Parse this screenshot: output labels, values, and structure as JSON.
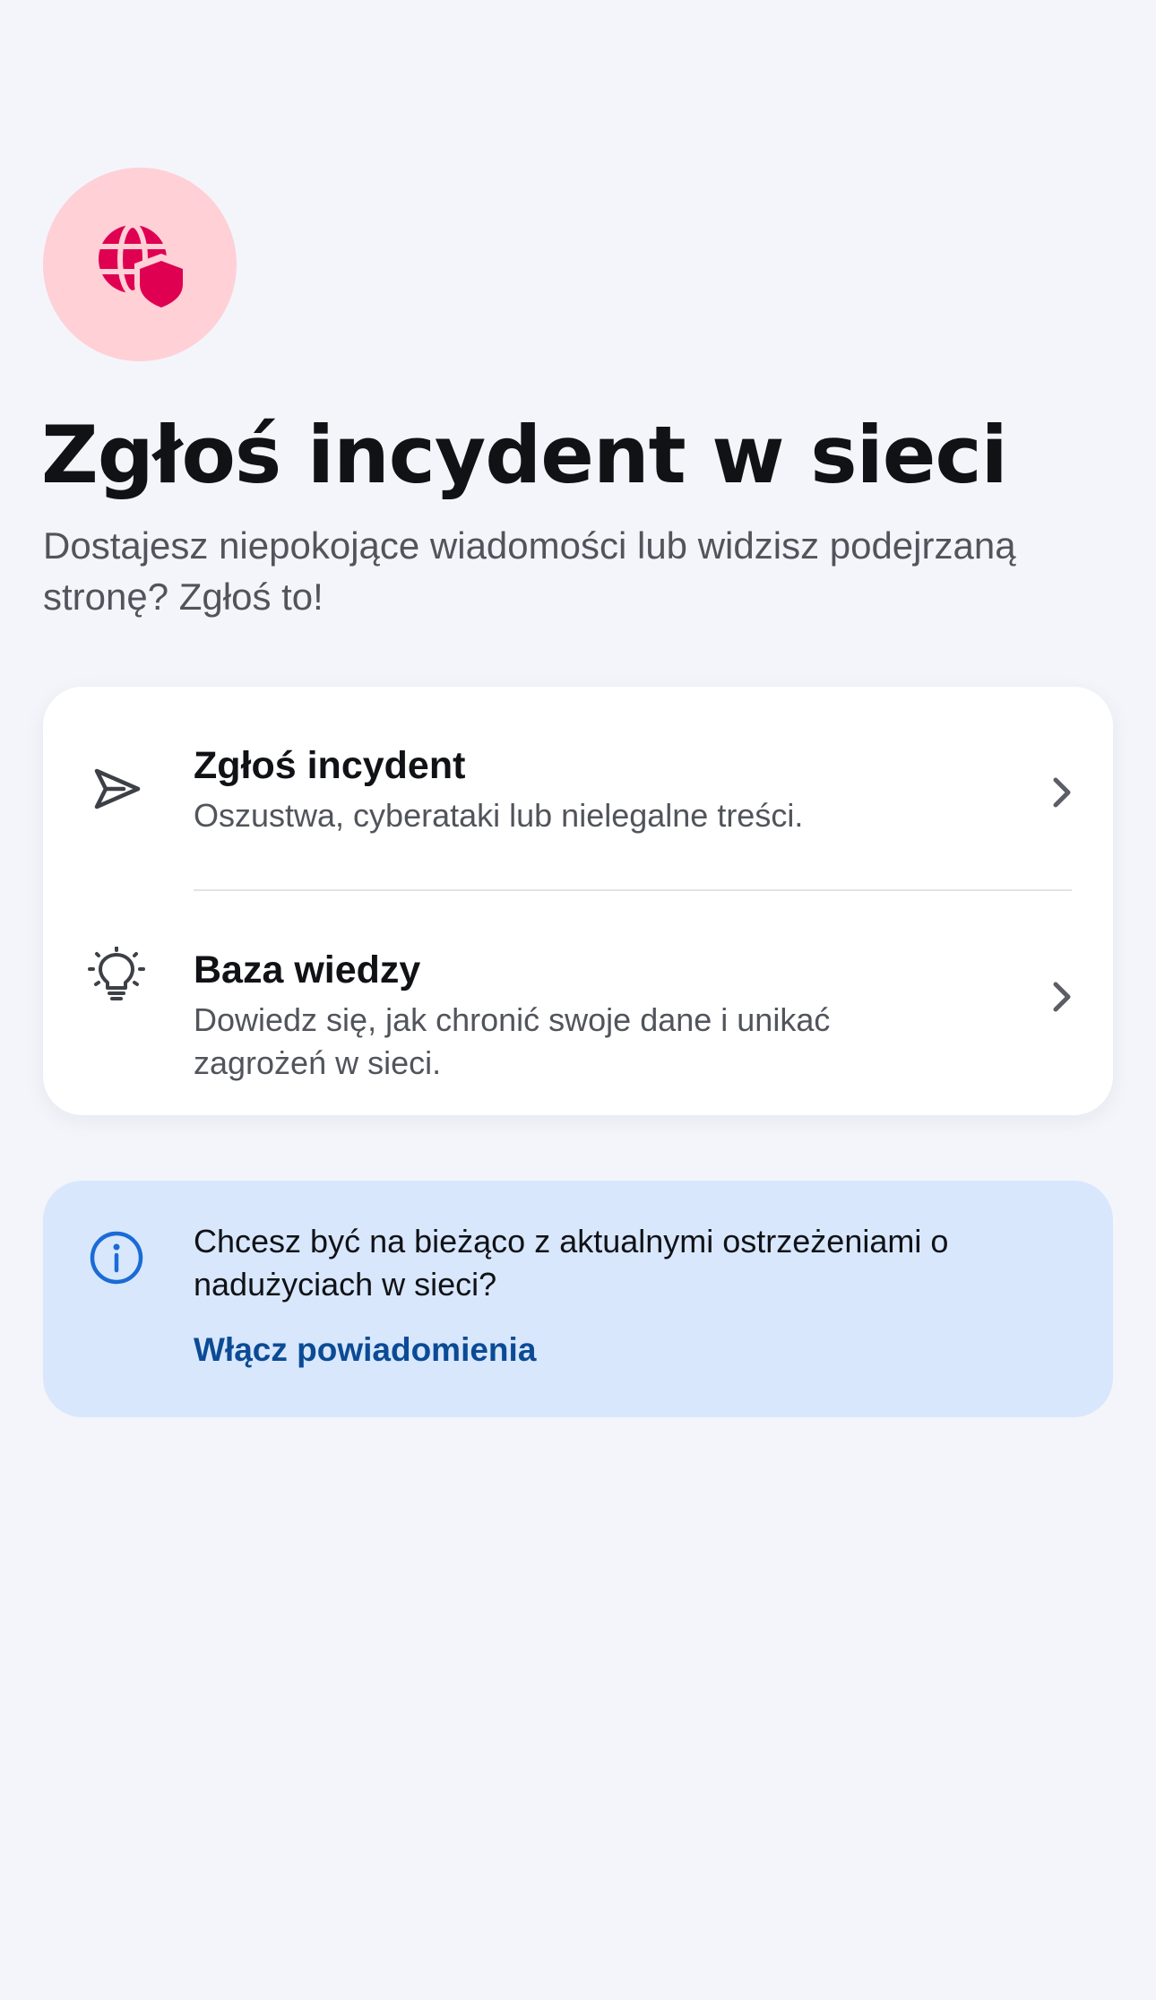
{
  "hero": {
    "icon": "globe-shield-icon",
    "badge_color": "#ffd0d6",
    "icon_color": "#df0052"
  },
  "page": {
    "title": "Zgłoś incydent w sieci",
    "subtitle": "Dostajesz niepokojące wiadomości lub widzisz podejrzaną stronę? Zgłoś to!"
  },
  "menu": {
    "items": [
      {
        "icon": "send-icon",
        "title": "Zgłoś incydent",
        "description": "Oszustwa, cyberataki lub nielegalne treści.",
        "trailing_icon": "chevron-right-icon"
      },
      {
        "icon": "lightbulb-icon",
        "title": "Baza wiedzy",
        "description": "Dowiedz się, jak chronić swoje dane i unikać zagrożeń w sieci.",
        "trailing_icon": "chevron-right-icon"
      }
    ]
  },
  "notice": {
    "icon": "info-icon",
    "text": "Chcesz być na bieżąco z aktualnymi ostrzeżeniami o nadużyciach w sieci?",
    "link_label": "Włącz powiadomienia",
    "background_color": "#d8e7fc",
    "link_color": "#0b4b95",
    "icon_color": "#1a6bd6"
  }
}
